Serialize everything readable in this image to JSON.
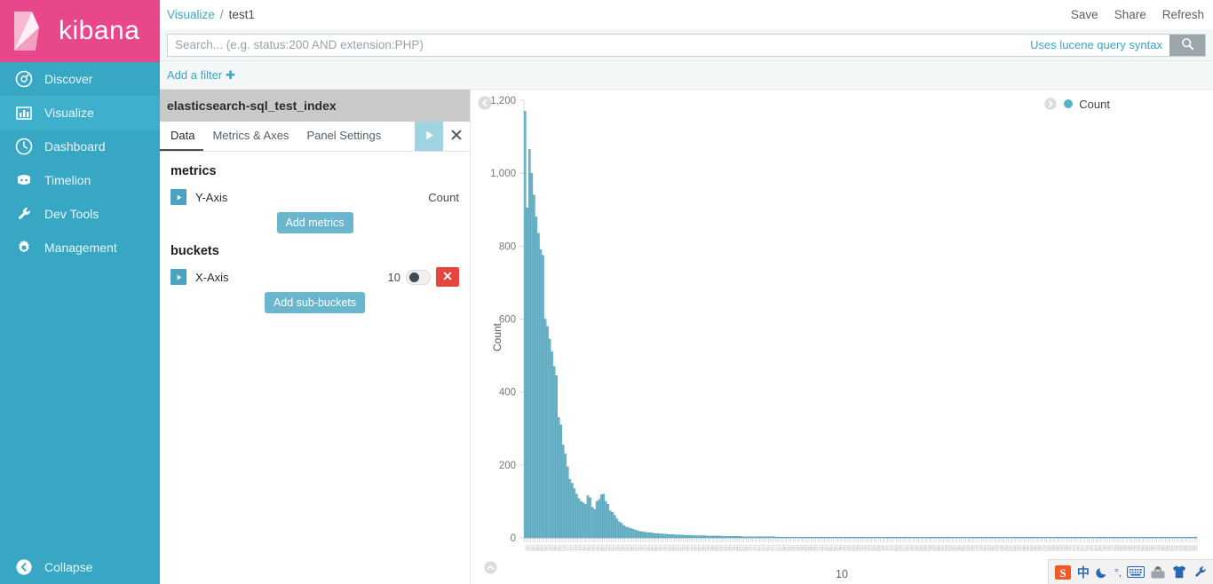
{
  "brand": {
    "name": "kibana"
  },
  "sidebar": {
    "items": [
      {
        "label": "Discover",
        "icon": "compass-icon",
        "active": false
      },
      {
        "label": "Visualize",
        "icon": "barchart-icon",
        "active": true
      },
      {
        "label": "Dashboard",
        "icon": "clock-icon",
        "active": false
      },
      {
        "label": "Timelion",
        "icon": "timelion-icon",
        "active": false
      },
      {
        "label": "Dev Tools",
        "icon": "wrench-icon",
        "active": false
      },
      {
        "label": "Management",
        "icon": "gear-icon",
        "active": false
      }
    ],
    "collapse": {
      "label": "Collapse",
      "icon": "chevron-left-circle-icon"
    }
  },
  "breadcrumb": {
    "parent": "Visualize",
    "separator": "/",
    "current": "test1"
  },
  "topbar_actions": [
    {
      "label": "Save"
    },
    {
      "label": "Share"
    },
    {
      "label": "Refresh"
    }
  ],
  "search": {
    "value": "",
    "placeholder": "Search... (e.g. status:200 AND extension:PHP)",
    "hint": "Uses lucene query syntax",
    "button_icon": "search-icon"
  },
  "filter_bar": {
    "add_filter_label": "Add a filter",
    "add_filter_plus": "✚"
  },
  "editor": {
    "index_title": "elasticsearch-sql_test_index",
    "tabs": [
      {
        "label": "Data",
        "active": true
      },
      {
        "label": "Metrics & Axes",
        "active": false
      },
      {
        "label": "Panel Settings",
        "active": false
      }
    ],
    "apply_icon": "play-icon",
    "close_icon": "close-icon",
    "metrics": {
      "section_label": "metrics",
      "rows": [
        {
          "label": "Y-Axis",
          "value": "Count"
        }
      ],
      "add_button": "Add metrics"
    },
    "buckets": {
      "section_label": "buckets",
      "rows": [
        {
          "label": "X-Axis",
          "value": "10",
          "toggle_on": true,
          "delete_icon": "close-icon"
        }
      ],
      "add_button": "Add sub-buckets"
    }
  },
  "chart_pane": {
    "collapse_editor_icon": "chevron-left-circle-icon",
    "legend_toggle_icon": "chevron-right-circle-icon",
    "scroll_top_icon": "chevron-up-circle-icon"
  },
  "ime_tray": {
    "items": [
      {
        "name": "sogou-logo-icon",
        "glyph": "S"
      },
      {
        "name": "chinese-mode-icon",
        "glyph": "中"
      },
      {
        "name": "moon-icon",
        "glyph": "☽"
      },
      {
        "name": "punctuation-icon",
        "glyph": "°,"
      },
      {
        "name": "soft-keyboard-icon",
        "glyph": "⌨"
      },
      {
        "name": "toolbox-icon",
        "glyph": "🧰"
      },
      {
        "name": "skin-shirt-icon",
        "glyph": "👕"
      },
      {
        "name": "settings-wrench-icon",
        "glyph": "🔧"
      }
    ]
  },
  "chart_data": {
    "type": "bar",
    "title": "",
    "xlabel": "10",
    "ylabel": "Count",
    "ylim": [
      0,
      1200
    ],
    "yticks": [
      0,
      200,
      400,
      600,
      800,
      1000,
      1200
    ],
    "ytick_labels": [
      "0",
      "200",
      "400",
      "600",
      "800",
      "1,000",
      "1,200"
    ],
    "grid": false,
    "legend": {
      "position": "top-right",
      "entries": [
        "Count"
      ]
    },
    "bar_color": "#6EB6CB",
    "bar_stroke": "#4E9CB3",
    "series": [
      {
        "name": "Count",
        "values": [
          1170,
          905,
          1065,
          1000,
          940,
          880,
          835,
          790,
          775,
          600,
          580,
          545,
          510,
          470,
          445,
          330,
          310,
          255,
          230,
          195,
          160,
          150,
          135,
          120,
          108,
          100,
          96,
          92,
          116,
          110,
          84,
          78,
          100,
          105,
          118,
          120,
          100,
          92,
          74,
          70,
          62,
          52,
          44,
          40,
          34,
          30,
          28,
          26,
          24,
          22,
          20,
          18,
          17,
          16,
          15,
          14,
          14,
          13,
          12,
          12,
          11,
          11,
          10,
          10,
          9,
          9,
          9,
          8,
          8,
          8,
          8,
          7,
          7,
          7,
          7,
          6,
          6,
          6,
          6,
          6,
          6,
          5,
          5,
          5,
          5,
          5,
          5,
          5,
          4,
          4,
          4,
          4,
          4,
          4,
          4,
          4,
          4,
          3,
          3,
          3,
          3,
          3,
          3,
          3,
          3,
          3,
          3,
          3,
          3,
          3,
          3,
          3,
          2,
          2,
          2,
          2,
          2,
          2,
          2,
          2,
          2,
          2,
          2,
          2,
          2,
          2,
          2,
          2,
          2,
          2,
          2,
          2,
          2,
          2,
          2,
          2,
          2,
          2,
          2,
          2,
          2,
          2,
          2,
          2,
          2,
          2,
          2,
          2,
          2,
          2,
          2,
          2,
          2,
          2,
          2,
          2,
          2,
          2,
          2,
          2,
          2,
          2,
          2,
          2,
          2,
          2,
          2,
          2,
          2,
          2,
          2,
          2,
          2,
          2,
          2,
          2,
          2,
          2,
          2,
          2,
          2,
          2,
          2,
          2,
          2,
          2,
          2,
          2,
          2,
          2,
          2,
          2,
          2,
          2,
          2,
          2,
          2,
          2,
          2,
          2,
          2,
          2,
          2,
          2,
          2,
          2,
          2,
          2,
          2,
          2,
          2,
          2,
          2,
          2,
          2,
          2,
          2,
          2,
          2,
          2,
          2,
          2,
          2,
          2,
          2,
          2,
          2,
          2,
          2,
          2,
          2,
          2,
          2,
          2,
          2,
          2,
          2,
          2,
          2,
          2,
          2,
          2,
          2,
          2,
          2,
          2,
          2,
          2,
          2,
          2,
          2,
          2,
          2,
          2,
          2,
          2,
          2,
          2,
          2,
          2,
          2,
          2,
          2,
          2,
          2,
          2,
          2,
          2,
          2,
          2,
          2,
          2,
          2,
          2,
          2,
          2,
          2,
          2,
          2,
          2,
          2,
          2,
          2,
          2,
          2,
          2,
          2,
          2,
          2,
          2,
          2,
          2,
          2,
          2,
          2,
          2,
          2,
          2,
          2,
          2
        ]
      }
    ]
  }
}
